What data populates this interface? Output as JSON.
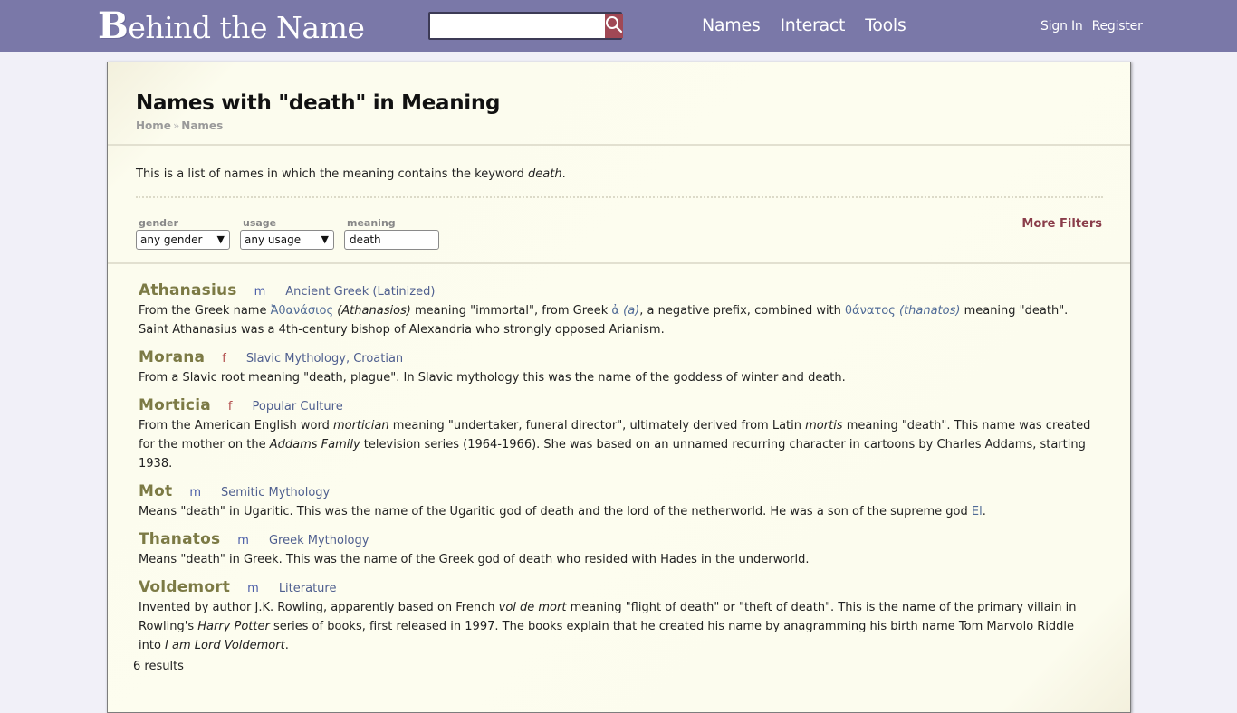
{
  "site": {
    "logo_text": "ehind the Name",
    "logo_initial": "B",
    "search_placeholder": "",
    "search_value": ""
  },
  "nav": {
    "items": [
      "Names",
      "Interact",
      "Tools"
    ],
    "sign_in": "Sign In",
    "register": "Register"
  },
  "page": {
    "title": "Names with \"death\" in Meaning",
    "breadcrumb": [
      "Home",
      "Names"
    ],
    "breadcrumb_sep": "»",
    "intro_text": "This is a list of names in which the meaning contains the keyword ",
    "intro_keyword": "death",
    "intro_end": "."
  },
  "filters": {
    "gender_label": "gender",
    "gender_value": "any gender",
    "usage_label": "usage",
    "usage_value": "any usage",
    "meaning_label": "meaning",
    "meaning_value": "death",
    "more_filters": "More Filters"
  },
  "results": [
    {
      "name": "Athanasius",
      "gender": "m",
      "usage": "Ancient Greek (Latinized)",
      "parts": [
        {
          "t": "From the Greek name "
        },
        {
          "t": "Ἀθανάσιος",
          "s": "gk"
        },
        {
          "t": " "
        },
        {
          "t": "(Athanasios)",
          "s": "i"
        },
        {
          "t": " meaning \"immortal\", from Greek "
        },
        {
          "t": "ἀ",
          "s": "gk"
        },
        {
          "t": " "
        },
        {
          "t": "(a)",
          "s": "gki"
        },
        {
          "t": ", a negative prefix, combined with "
        },
        {
          "t": "θάνατος",
          "s": "gk"
        },
        {
          "t": " "
        },
        {
          "t": "(thanatos)",
          "s": "gki"
        },
        {
          "t": " meaning \"death\". Saint Athanasius was a 4th-century bishop of Alexandria who strongly opposed Arianism."
        }
      ]
    },
    {
      "name": "Morana",
      "gender": "f",
      "usage": "Slavic Mythology, Croatian",
      "parts": [
        {
          "t": "From a Slavic root meaning \"death, plague\". In Slavic mythology this was the name of the goddess of winter and death."
        }
      ]
    },
    {
      "name": "Morticia",
      "gender": "f",
      "usage": "Popular Culture",
      "parts": [
        {
          "t": "From the American English word "
        },
        {
          "t": "mortician",
          "s": "i"
        },
        {
          "t": " meaning \"undertaker, funeral director\", ultimately derived from Latin "
        },
        {
          "t": "mortis",
          "s": "i"
        },
        {
          "t": " meaning \"death\". This name was created for the mother on the "
        },
        {
          "t": "Addams Family",
          "s": "i"
        },
        {
          "t": " television series (1964-1966). She was based on an unnamed recurring character in cartoons by Charles Addams, starting 1938."
        }
      ]
    },
    {
      "name": "Mot",
      "gender": "m",
      "usage": "Semitic Mythology",
      "parts": [
        {
          "t": "Means \"death\" in Ugaritic. This was the name of the Ugaritic god of death and the lord of the netherworld. He was a son of the supreme god "
        },
        {
          "t": "El",
          "s": "link"
        },
        {
          "t": "."
        }
      ]
    },
    {
      "name": "Thanatos",
      "gender": "m",
      "usage": "Greek Mythology",
      "parts": [
        {
          "t": "Means \"death\" in Greek. This was the name of the Greek god of death who resided with Hades in the underworld."
        }
      ]
    },
    {
      "name": "Voldemort",
      "gender": "m",
      "usage": "Literature",
      "parts": [
        {
          "t": "Invented by author J.K. Rowling, apparently based on French "
        },
        {
          "t": "vol de mort",
          "s": "i"
        },
        {
          "t": " meaning \"flight of death\" or \"theft of death\". This is the name of the primary villain in Rowling's "
        },
        {
          "t": "Harry Potter",
          "s": "i"
        },
        {
          "t": " series of books, first released in 1997. The books explain that he created his name by anagramming his birth name Tom Marvolo Riddle into "
        },
        {
          "t": "I am Lord Voldemort",
          "s": "i"
        },
        {
          "t": "."
        }
      ]
    }
  ],
  "result_count": "6 results",
  "colors": {
    "topbar": "#7a78a8",
    "search_button": "#a04855",
    "name_link": "#7c7a45",
    "male": "#4b5ea8",
    "female": "#b04a4a",
    "more_filters": "#8a3d4a"
  }
}
